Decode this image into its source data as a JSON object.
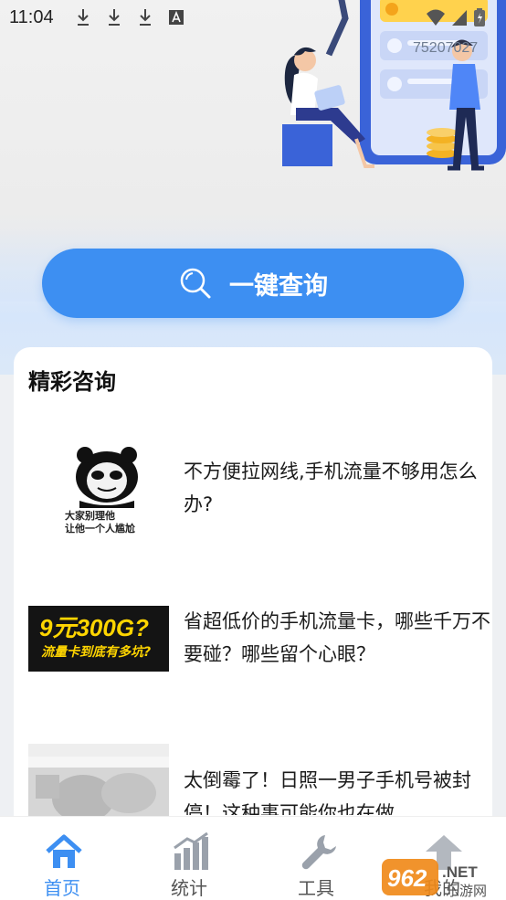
{
  "status_bar": {
    "time": "11:04",
    "ticker": "75207027"
  },
  "search": {
    "label": "一键查询"
  },
  "section": {
    "title": "精彩咨询"
  },
  "articles": [
    {
      "title": "不方便拉网线,手机流量不够用怎么办?",
      "thumb_text_1": "大家别理他",
      "thumb_text_2": "让他一个人尴尬"
    },
    {
      "title": "省超低价的手机流量卡，哪些千万不要碰？哪些留个心眼？",
      "thumb_text_1": "9元300G?",
      "thumb_text_2": "流量卡到底有多坑?"
    },
    {
      "title": "太倒霉了！日照一男子手机号被封停！这种事可能你也在做..."
    }
  ],
  "nav": {
    "items": [
      {
        "label": "首页",
        "icon": "home-icon",
        "active": true
      },
      {
        "label": "统计",
        "icon": "chart-icon",
        "active": false
      },
      {
        "label": "工具",
        "icon": "wrench-icon",
        "active": false
      },
      {
        "label": "我的",
        "icon": "up-arrow-icon",
        "active": false
      }
    ]
  },
  "watermark": {
    "brand": "962.NET",
    "sub": "乐游网"
  },
  "colors": {
    "accent": "#3d8ff2",
    "nav_inactive": "#9aa1ab"
  }
}
